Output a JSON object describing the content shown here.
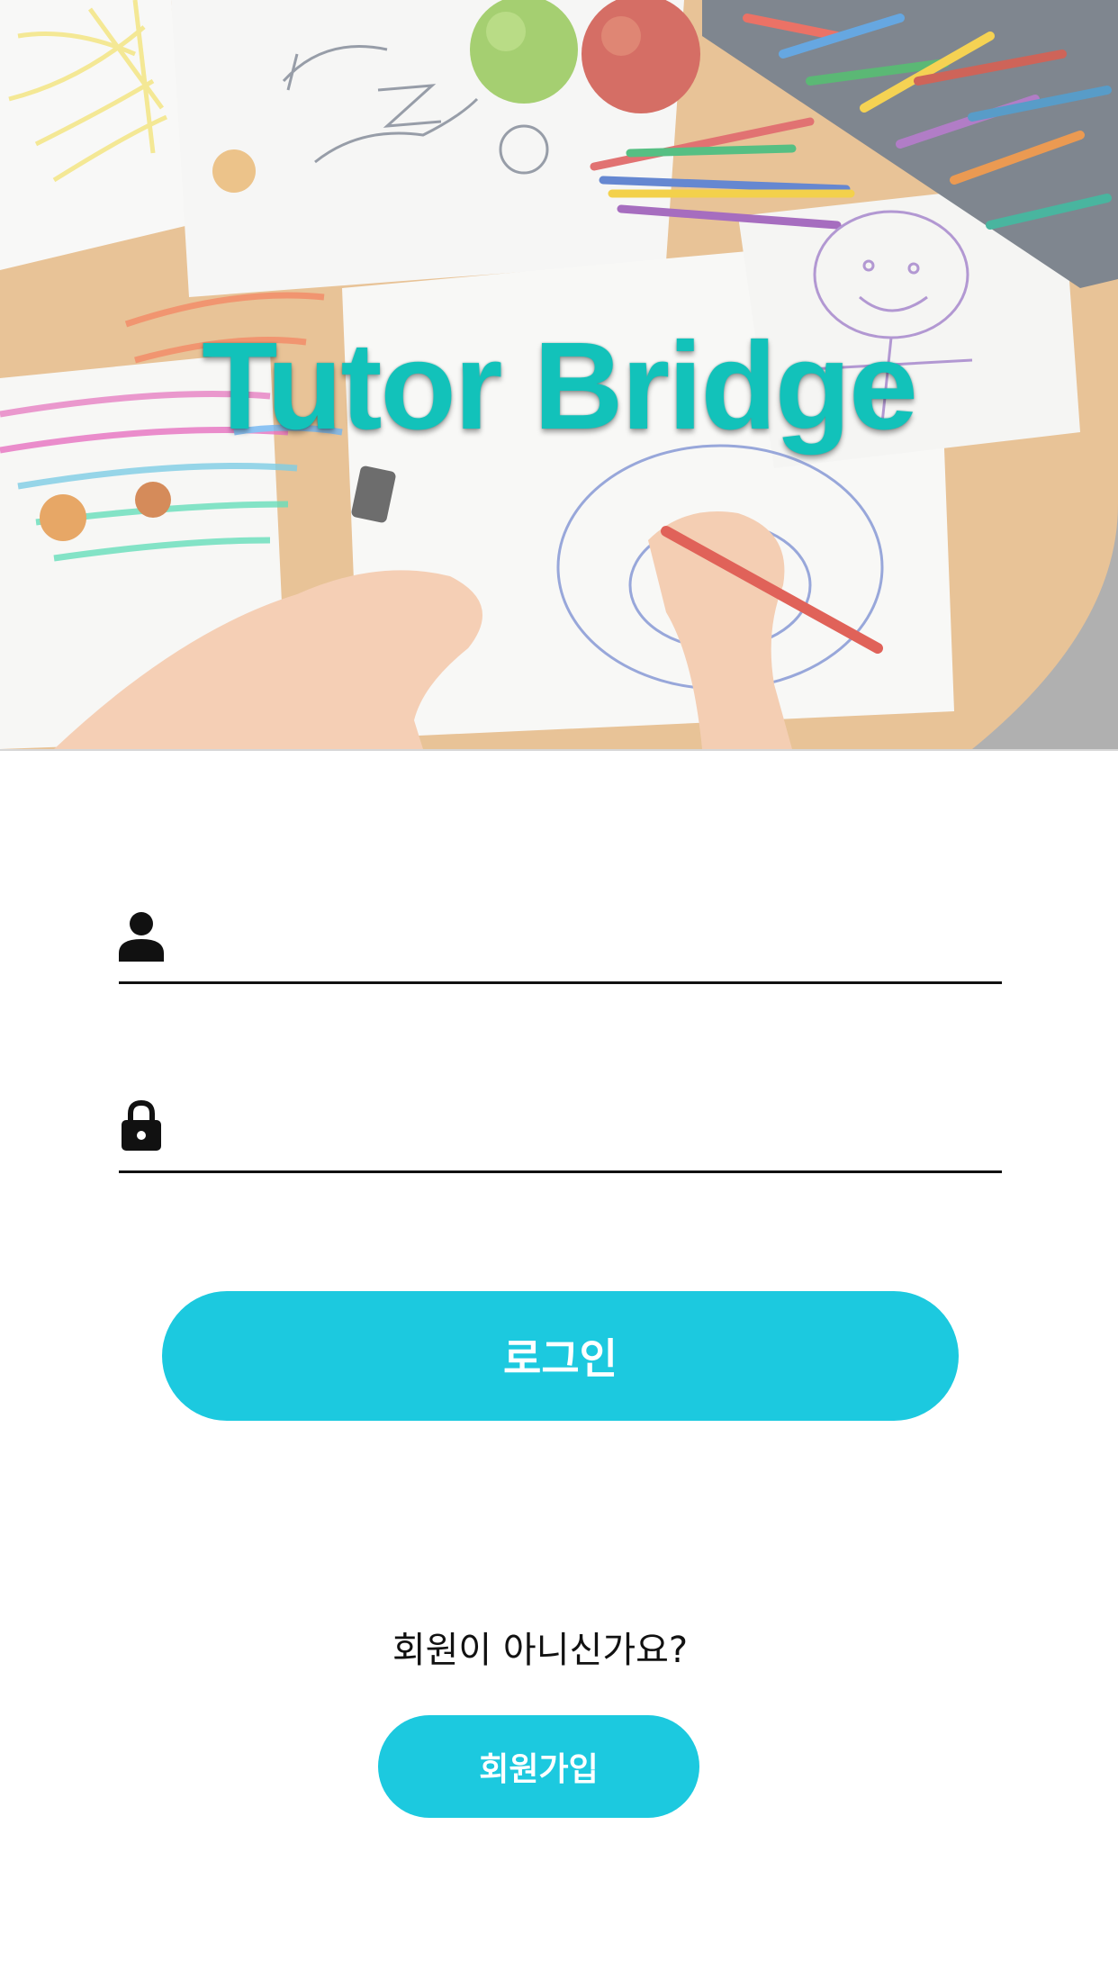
{
  "hero": {
    "title": "Tutor Bridge",
    "image": "children-drawing-on-paper-with-crayons"
  },
  "login_form": {
    "username": {
      "icon": "person-icon",
      "value": "",
      "placeholder": ""
    },
    "password": {
      "icon": "lock-icon",
      "value": "",
      "placeholder": ""
    },
    "login_label": "로그인"
  },
  "signup": {
    "prompt": "회원이 아니신가요?",
    "button_label": "회원가입"
  },
  "colors": {
    "accent": "#1cc9df",
    "title": "#12c2ba",
    "text": "#111111",
    "background": "#ffffff"
  }
}
